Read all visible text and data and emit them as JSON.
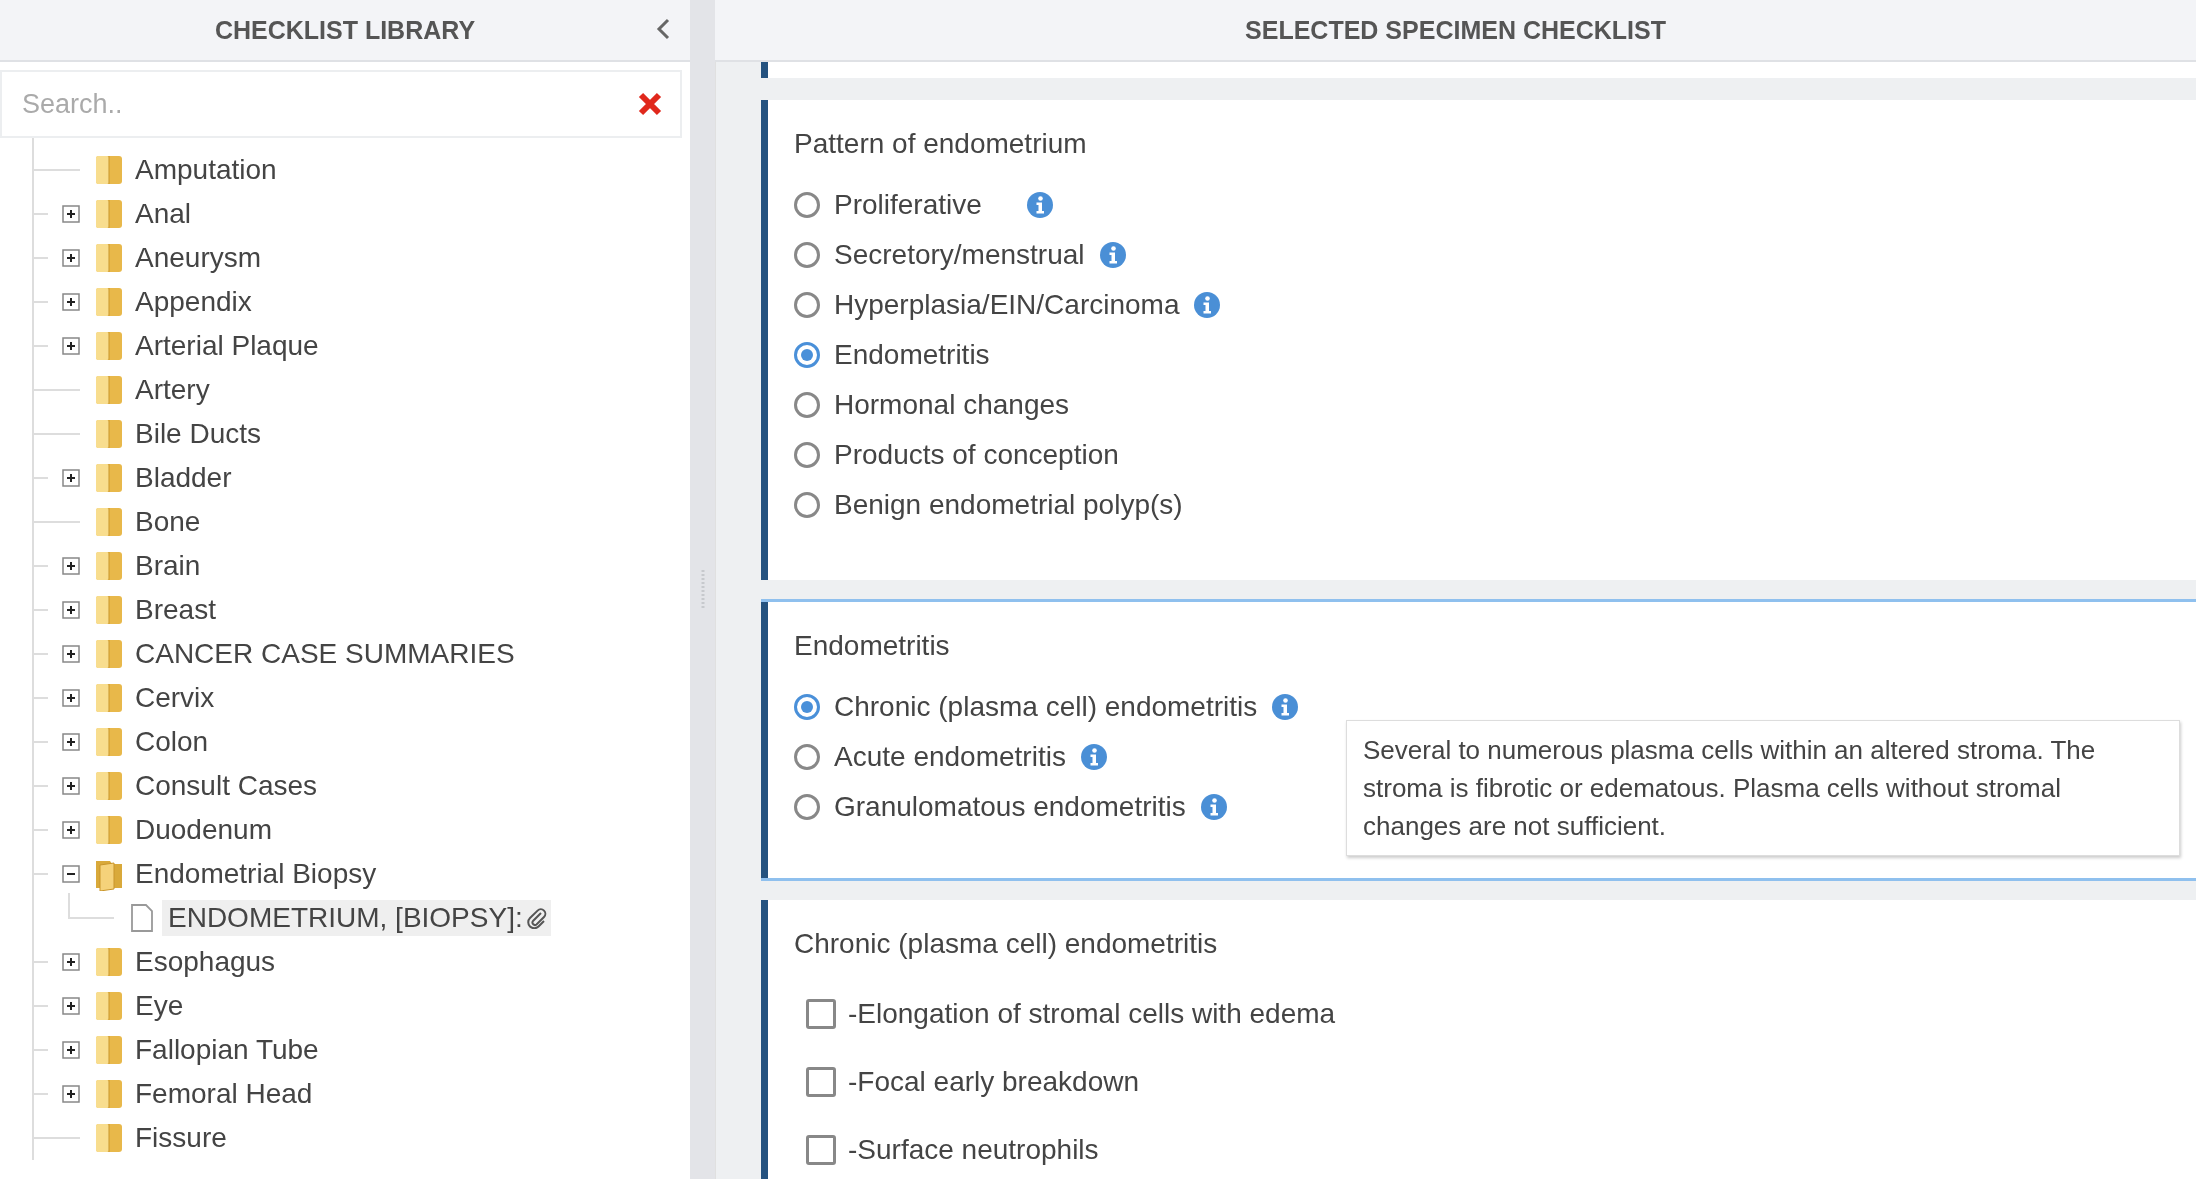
{
  "library": {
    "title": "CHECKLIST LIBRARY",
    "search": {
      "placeholder": "Search.."
    },
    "items": [
      {
        "label": "Amputation",
        "expandable": false,
        "expanded": false
      },
      {
        "label": "Anal",
        "expandable": true,
        "expanded": false
      },
      {
        "label": "Aneurysm",
        "expandable": true,
        "expanded": false
      },
      {
        "label": "Appendix",
        "expandable": true,
        "expanded": false
      },
      {
        "label": "Arterial Plaque",
        "expandable": true,
        "expanded": false
      },
      {
        "label": "Artery",
        "expandable": false,
        "expanded": false
      },
      {
        "label": "Bile Ducts",
        "expandable": false,
        "expanded": false
      },
      {
        "label": "Bladder",
        "expandable": true,
        "expanded": false
      },
      {
        "label": "Bone",
        "expandable": false,
        "expanded": false
      },
      {
        "label": "Brain",
        "expandable": true,
        "expanded": false
      },
      {
        "label": "Breast",
        "expandable": true,
        "expanded": false
      },
      {
        "label": "CANCER CASE SUMMARIES",
        "expandable": true,
        "expanded": false
      },
      {
        "label": "Cervix",
        "expandable": true,
        "expanded": false
      },
      {
        "label": "Colon",
        "expandable": true,
        "expanded": false
      },
      {
        "label": "Consult Cases",
        "expandable": true,
        "expanded": false
      },
      {
        "label": "Duodenum",
        "expandable": true,
        "expanded": false
      },
      {
        "label": "Endometrial Biopsy",
        "expandable": true,
        "expanded": true,
        "children": [
          {
            "label": "ENDOMETRIUM, [BIOPSY]:",
            "selected": true,
            "attachment": true
          }
        ]
      },
      {
        "label": "Esophagus",
        "expandable": true,
        "expanded": false
      },
      {
        "label": "Eye",
        "expandable": true,
        "expanded": false
      },
      {
        "label": "Fallopian Tube",
        "expandable": true,
        "expanded": false
      },
      {
        "label": "Femoral Head",
        "expandable": true,
        "expanded": false
      },
      {
        "label": "Fissure",
        "expandable": false,
        "expanded": false
      }
    ]
  },
  "checklist": {
    "title": "SELECTED SPECIMEN CHECKLIST",
    "sections": [
      {
        "heading": "Pattern of endometrium",
        "highlighted": false,
        "options": [
          {
            "kind": "radio",
            "label": "Proliferative",
            "selected": false,
            "info": true
          },
          {
            "kind": "radio",
            "label": "Secretory/menstrual",
            "selected": false,
            "info": true
          },
          {
            "kind": "radio",
            "label": "Hyperplasia/EIN/Carcinoma",
            "selected": false,
            "info": true
          },
          {
            "kind": "radio",
            "label": "Endometritis",
            "selected": true,
            "info": false
          },
          {
            "kind": "radio",
            "label": "Hormonal changes",
            "selected": false,
            "info": false
          },
          {
            "kind": "radio",
            "label": "Products of conception",
            "selected": false,
            "info": false
          },
          {
            "kind": "radio",
            "label": "Benign endometrial polyp(s)",
            "selected": false,
            "info": false
          }
        ]
      },
      {
        "heading": "Endometritis",
        "highlighted": true,
        "tooltip": "Several to numerous plasma cells within an altered stroma. The stroma is fibrotic or edematous. Plasma cells without stromal changes are not sufficient.",
        "options": [
          {
            "kind": "radio",
            "label": "Chronic (plasma cell) endometritis",
            "selected": true,
            "info": true
          },
          {
            "kind": "radio",
            "label": "Acute endometritis",
            "selected": false,
            "info": true
          },
          {
            "kind": "radio",
            "label": "Granulomatous endometritis",
            "selected": false,
            "info": true
          }
        ]
      },
      {
        "heading": "Chronic (plasma cell) endometritis",
        "highlighted": false,
        "options": [
          {
            "kind": "checkbox",
            "label": "-Elongation of stromal cells with edema",
            "checked": false
          },
          {
            "kind": "checkbox",
            "label": "-Focal early breakdown",
            "checked": false
          },
          {
            "kind": "checkbox",
            "label": "-Surface neutrophils",
            "checked": false
          }
        ]
      }
    ]
  }
}
